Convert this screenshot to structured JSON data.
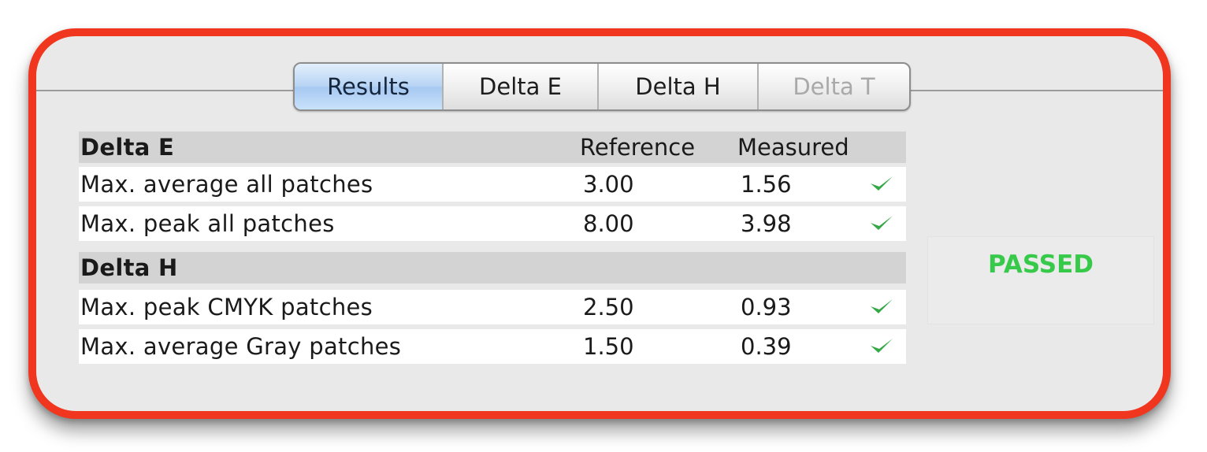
{
  "tabs": [
    {
      "label": "Results",
      "state": "selected"
    },
    {
      "label": "Delta E",
      "state": "normal"
    },
    {
      "label": "Delta H",
      "state": "normal"
    },
    {
      "label": "Delta T",
      "state": "disabled"
    }
  ],
  "delta_e": {
    "title": "Delta E",
    "col_reference": "Reference",
    "col_measured": "Measured",
    "rows": [
      {
        "name": "Max. average all patches",
        "reference": "3.00",
        "measured": "1.56",
        "status": "check-icon"
      },
      {
        "name": "Max. peak all patches",
        "reference": "8.00",
        "measured": "3.98",
        "status": "check-icon"
      }
    ]
  },
  "delta_h": {
    "title": "Delta H",
    "rows": [
      {
        "name": "Max. peak CMYK patches",
        "reference": "2.50",
        "measured": "0.93",
        "status": "check-icon"
      },
      {
        "name": "Max. average Gray patches",
        "reference": "1.50",
        "measured": "0.39",
        "status": "check-icon"
      }
    ]
  },
  "result": {
    "label": "PASSED",
    "color": "#37c94a"
  },
  "colors": {
    "frame": "#f0361f",
    "check": "#34a845",
    "selected_tab": "#b6d3f4"
  }
}
